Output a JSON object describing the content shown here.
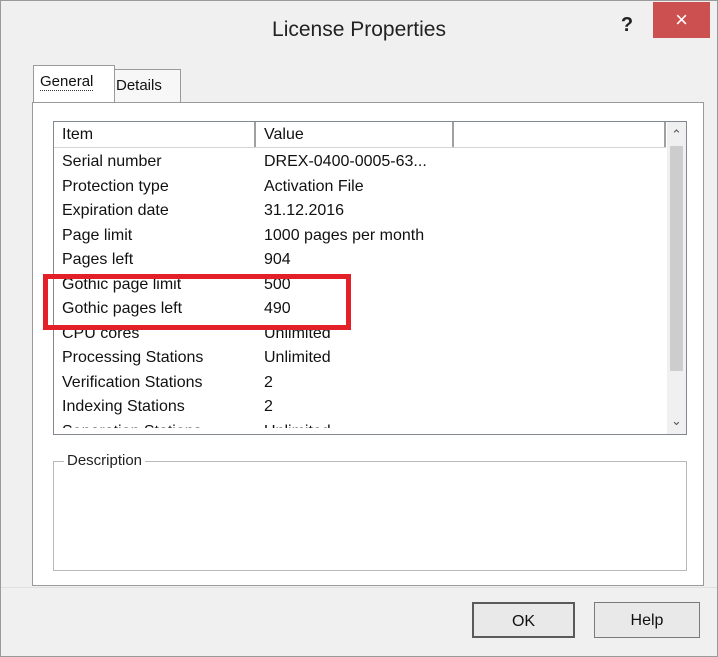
{
  "window": {
    "title": "License Properties",
    "help_glyph": "?",
    "close_glyph": "×"
  },
  "tabs": [
    {
      "label": "General",
      "active": true
    },
    {
      "label": "Details",
      "active": false
    }
  ],
  "list": {
    "columns": [
      "Item",
      "Value",
      ""
    ],
    "rows": [
      {
        "item": "Serial number",
        "value": "DREX-0400-0005-63..."
      },
      {
        "item": "Protection type",
        "value": "Activation File"
      },
      {
        "item": "Expiration date",
        "value": "31.12.2016"
      },
      {
        "item": "Page limit",
        "value": "1000 pages per month"
      },
      {
        "item": "Pages left",
        "value": "904"
      },
      {
        "item": "Gothic page limit",
        "value": "500"
      },
      {
        "item": "Gothic pages left",
        "value": "490"
      },
      {
        "item": "CPU cores",
        "value": "Unlimited"
      },
      {
        "item": "Processing Stations",
        "value": "Unlimited"
      },
      {
        "item": "Verification Stations",
        "value": "2"
      },
      {
        "item": "Indexing Stations",
        "value": "2"
      },
      {
        "item": "Separation Stations",
        "value": "Unlimited"
      }
    ],
    "scroll_up_glyph": "⌃",
    "scroll_down_glyph": "⌄"
  },
  "description": {
    "legend": "Description",
    "text": ""
  },
  "buttons": {
    "ok": "OK",
    "help": "Help"
  },
  "colors": {
    "highlight": "#e32027",
    "close_button": "#cc5050"
  }
}
